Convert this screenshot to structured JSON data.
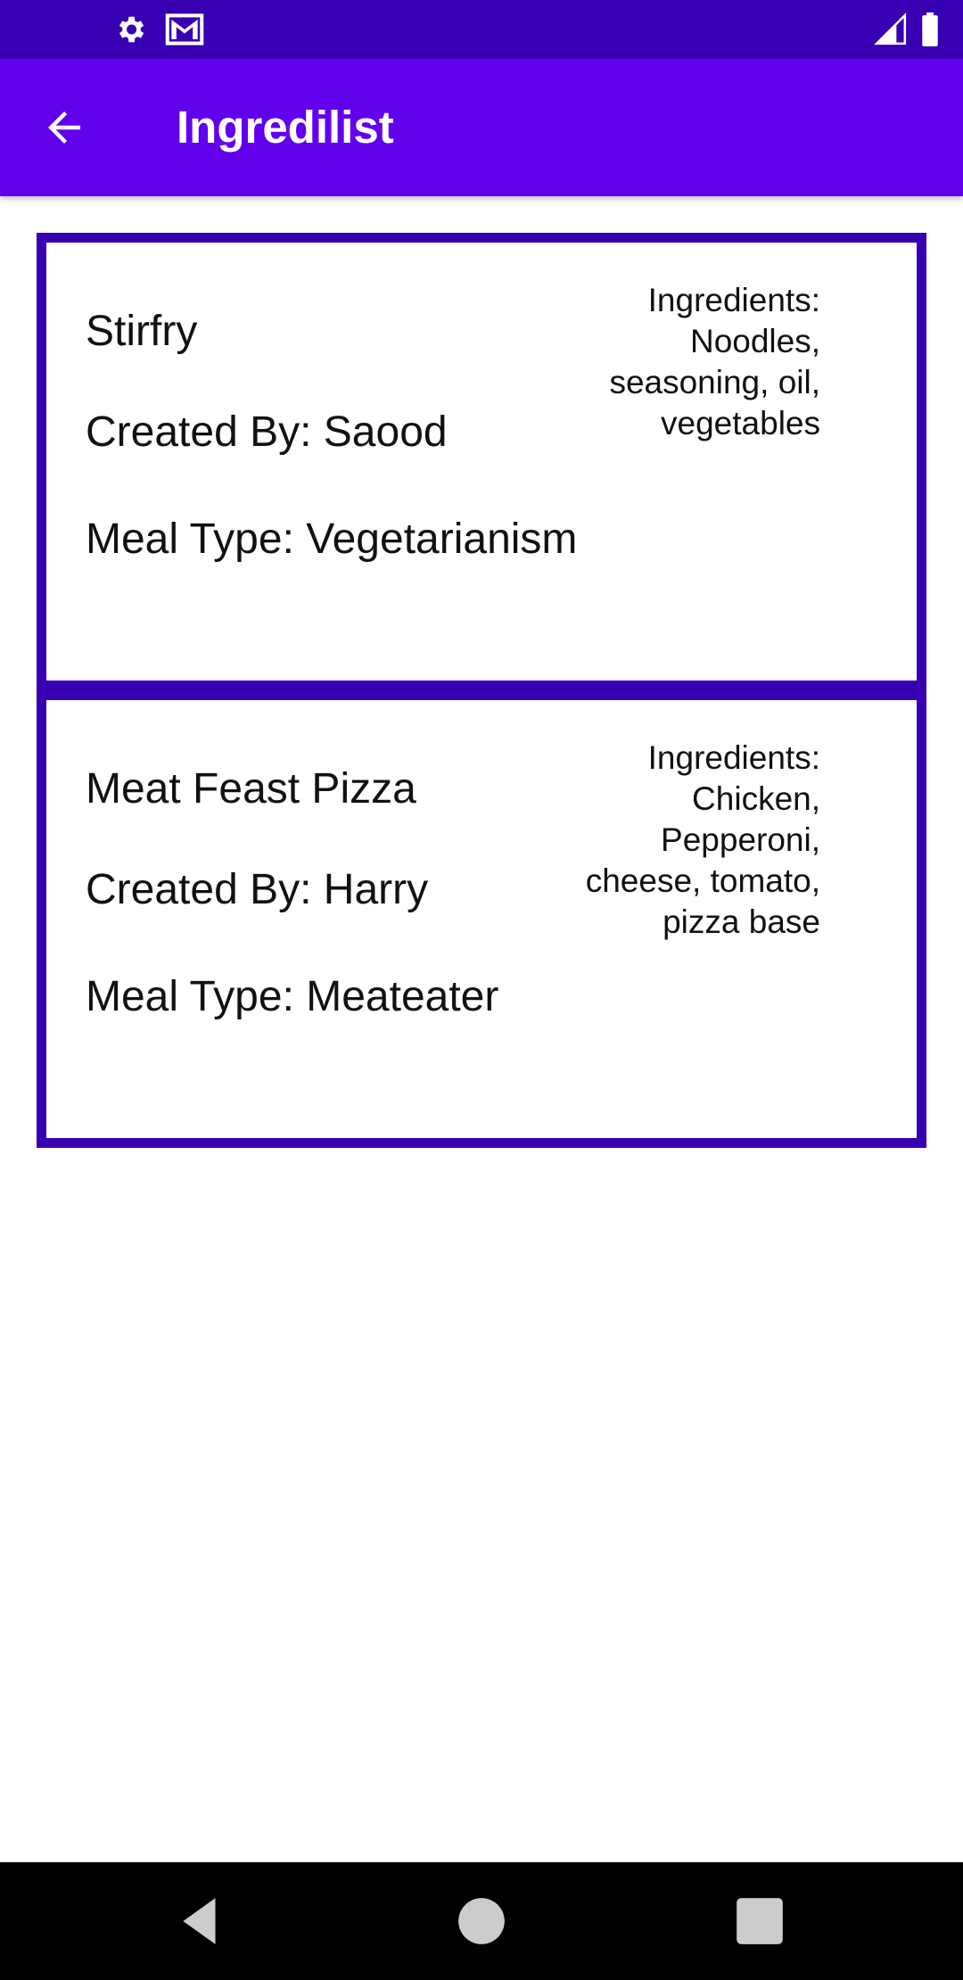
{
  "app_bar": {
    "title": "Ingredilist",
    "back_icon": "arrow-left-icon"
  },
  "status_bar": {
    "icons": [
      "gear-icon",
      "gmail-icon",
      "signal-icon",
      "battery-icon"
    ]
  },
  "recipes": [
    {
      "name": "Stirfry",
      "created_by": "Created By: Saood",
      "meal_type": "Meal Type: Vegetarianism",
      "ingredients": "Ingredients: Noodles, seasoning, oil, vegetables"
    },
    {
      "name": "Meat Feast Pizza",
      "created_by": "Created By: Harry",
      "meal_type": "Meal Type: Meateater",
      "ingredients": "Ingredients: Chicken, Pepperoni, cheese, tomato, pizza base"
    }
  ],
  "colors": {
    "status_bar": "#3700b3",
    "app_bar": "#6200ee",
    "card_border": "#3700b3"
  },
  "nav_bar": {
    "icons": [
      "back-triangle-icon",
      "home-circle-icon",
      "recents-square-icon"
    ]
  }
}
